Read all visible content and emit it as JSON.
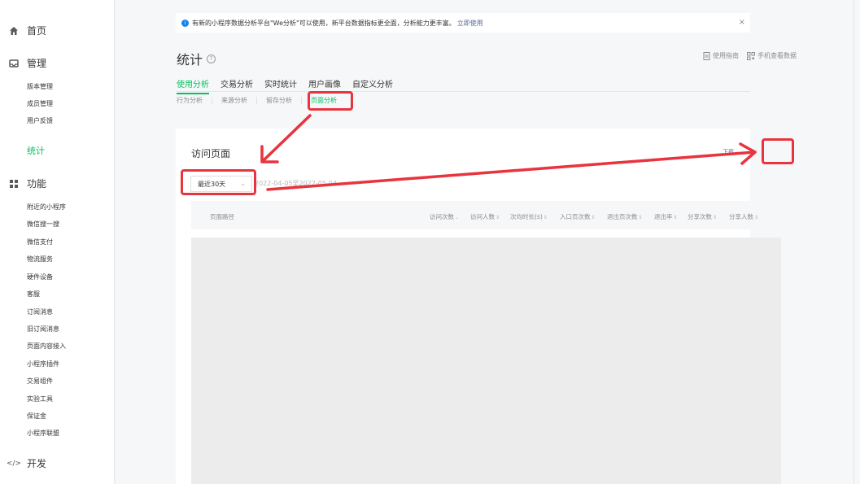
{
  "sidebar": {
    "home": "首页",
    "manage": "管理",
    "manage_items": [
      "版本管理",
      "成员管理",
      "用户反馈"
    ],
    "stats": "统计",
    "features": "功能",
    "feature_items": [
      "附近的小程序",
      "微信搜一搜",
      "微信支付",
      "物流服务",
      "硬件设备",
      "客服",
      "订阅消息",
      "旧订阅消息",
      "页面内容接入",
      "小程序插件",
      "交易组件",
      "实验工具",
      "保证金",
      "小程序联盟"
    ],
    "dev": "开发"
  },
  "notice": {
    "text": "有新的小程序数据分析平台\"We分析\"可以使用，新平台数据指标更全面，分析能力更丰富。",
    "link": "立即使用",
    "close": "×"
  },
  "page": {
    "title": "统计",
    "guide": "使用指南",
    "mobile": "手机查看数据"
  },
  "tabs": [
    "使用分析",
    "交易分析",
    "实时统计",
    "用户画像",
    "自定义分析"
  ],
  "subtabs": [
    "行为分析",
    "来源分析",
    "留存分析",
    "页面分析"
  ],
  "card": {
    "title": "访问页面",
    "download": "下载",
    "select_value": "最近30天",
    "date_range": "2022-04-05至2022-05-04"
  },
  "table": {
    "path_header": "页面路径",
    "columns": [
      "访问次数",
      "访问人数",
      "次均时长(s)",
      "入口页次数",
      "退出页次数",
      "退出率",
      "分享次数",
      "分享人数"
    ]
  },
  "colors": {
    "accent": "#07c160",
    "annotation": "#e8343e",
    "link": "#576b95"
  }
}
